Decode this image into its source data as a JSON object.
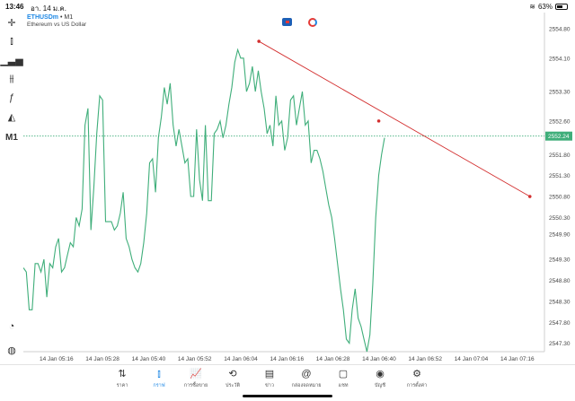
{
  "status": {
    "time": "13:46",
    "date": "อา. 14 ม.ค.",
    "battery": "63%",
    "battery_level": 0.63
  },
  "header": {
    "symbol": "ETHUSDm",
    "separator": "•",
    "timeframe": "M1",
    "description": "Ethereum vs US Dollar"
  },
  "toolbar": {
    "timeframe_label": "M1"
  },
  "colors": {
    "series": "#3fae7a",
    "trendline": "#d32f2f",
    "current_price_bg": "#3fae7a",
    "active_nav": "#1e88e5",
    "grid": "#e6e6e6"
  },
  "chart_data": {
    "type": "line",
    "price_axis": [
      "2554.80",
      "2554.10",
      "2553.30",
      "2552.60",
      "2551.80",
      "2551.30",
      "2550.80",
      "2550.30",
      "2549.90",
      "2549.30",
      "2548.80",
      "2548.30",
      "2547.80",
      "2547.30"
    ],
    "time_axis": [
      "14 Jan 05:16",
      "14 Jan 05:28",
      "14 Jan 05:40",
      "14 Jan 05:52",
      "14 Jan 06:04",
      "14 Jan 06:16",
      "14 Jan 06:28",
      "14 Jan 06:40",
      "14 Jan 06:52",
      "14 Jan 07:04",
      "14 Jan 07:16"
    ],
    "current_price": "2552.24",
    "current_value": 2552.24,
    "ylim": [
      2547.1,
      2555.1
    ],
    "series": [
      {
        "x": [
          0,
          1,
          2,
          3,
          4,
          5,
          6,
          7,
          8,
          9,
          10,
          11,
          12,
          13,
          14,
          15,
          16,
          17,
          18,
          19,
          20,
          21,
          22,
          23,
          24,
          25,
          26,
          27,
          28,
          29,
          30,
          31,
          32,
          33,
          34,
          35,
          36,
          37,
          38,
          39,
          40,
          41,
          42,
          43,
          44,
          45,
          46,
          47,
          48,
          49,
          50,
          51,
          52,
          53,
          54,
          55,
          56,
          57,
          58,
          59,
          60,
          61,
          62,
          63,
          64,
          65,
          66,
          67,
          68,
          69,
          70,
          71,
          72,
          73,
          74,
          75,
          76,
          77,
          78,
          79,
          80,
          81,
          82,
          83,
          84,
          85,
          86,
          87,
          88,
          89,
          90,
          91,
          92,
          93,
          94,
          95,
          96,
          97,
          98,
          99
        ],
        "values": [
          2549.1,
          2549.0,
          2548.1,
          2548.1,
          2549.2,
          2549.2,
          2549.0,
          2549.3,
          2548.4,
          2549.2,
          2549.1,
          2549.6,
          2549.8,
          2549.0,
          2549.1,
          2549.4,
          2549.7,
          2549.6,
          2550.3,
          2550.1,
          2550.5,
          2552.5,
          2552.9,
          2550.0,
          2551.0,
          2552.3,
          2553.2,
          2553.1,
          2550.2,
          2550.2,
          2550.2,
          2550.0,
          2550.1,
          2550.4,
          2550.9,
          2549.8,
          2549.6,
          2549.3,
          2549.1,
          2549.0,
          2549.2,
          2549.7,
          2550.4,
          2551.6,
          2551.7,
          2550.9,
          2552.2,
          2552.7,
          2553.4,
          2553.0,
          2553.5,
          2552.5,
          2552.0,
          2552.4,
          2552.0,
          2551.6,
          2551.7,
          2550.8,
          2550.8,
          2552.4,
          2551.2,
          2550.7,
          2552.5,
          2550.7,
          2550.7,
          2552.3,
          2552.4,
          2552.6,
          2552.2,
          2552.5,
          2553.0,
          2553.4,
          2554.0,
          2554.3,
          2554.1,
          2554.1,
          2553.3,
          2553.5,
          2553.9,
          2553.3,
          2553.8,
          2553.3,
          2552.9,
          2552.3,
          2552.5,
          2552.0,
          2553.2,
          2552.5,
          2552.6,
          2551.9,
          2552.2,
          2553.1,
          2553.2,
          2552.5,
          2552.9,
          2553.3,
          2552.5,
          2552.6,
          2551.6,
          2551.9
        ],
        "tail": [
          2551.9,
          2551.7,
          2551.4,
          2551.0,
          2550.6,
          2550.3,
          2549.8,
          2549.2,
          2548.6,
          2548.1,
          2547.4,
          2547.3,
          2548.1,
          2548.6,
          2547.9,
          2547.7,
          2547.4,
          2547.1,
          2547.5,
          2548.7,
          2550.3,
          2551.3,
          2551.8,
          2552.2
        ]
      }
    ],
    "trendline": {
      "start": {
        "time_index": 0.452,
        "value": 2554.5
      },
      "mid": {
        "time_index": 0.682,
        "value": 2552.6
      },
      "end": {
        "time_index": 0.972,
        "value": 2550.8
      }
    }
  },
  "nav": [
    {
      "icon": "quotes-icon",
      "glyph": "⇅",
      "label": "ราคา"
    },
    {
      "icon": "chart-icon",
      "glyph": "⫾",
      "label": "กราฟ",
      "active": true
    },
    {
      "icon": "trade-icon",
      "glyph": "📈",
      "label": "การซื้อขาย"
    },
    {
      "icon": "history-icon",
      "glyph": "⟲",
      "label": "ประวัติ"
    },
    {
      "icon": "news-icon",
      "glyph": "▤",
      "label": "ข่าว"
    },
    {
      "icon": "mailbox-icon",
      "glyph": "@",
      "label": "กล่องจดหมาย"
    },
    {
      "icon": "chat-icon",
      "glyph": "▢",
      "label": "แชท"
    },
    {
      "icon": "account-icon",
      "glyph": "◉",
      "label": "บัญชี"
    },
    {
      "icon": "settings-icon",
      "glyph": "⚙",
      "label": "การตั้งค่า"
    }
  ]
}
